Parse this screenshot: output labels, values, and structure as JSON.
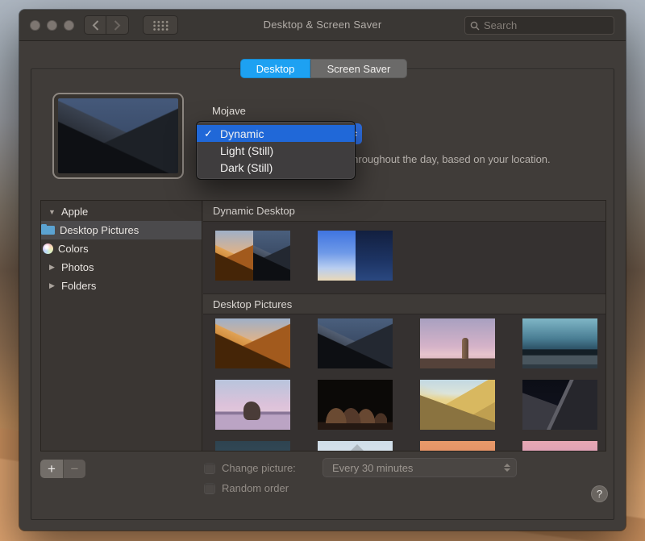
{
  "titlebar": {
    "title": "Desktop & Screen Saver",
    "search_placeholder": "Search"
  },
  "tabs": {
    "desktop": "Desktop",
    "screen_saver": "Screen Saver"
  },
  "preview": {
    "name": "Mojave",
    "caption": "The desktop picture changes throughout the day, based on your location."
  },
  "dropdown": {
    "checkmark": "✓",
    "selected": "Dynamic",
    "options": [
      "Dynamic",
      "Light (Still)",
      "Dark (Still)"
    ]
  },
  "sidebar": {
    "items": [
      {
        "label": "Apple",
        "state": "expanded"
      },
      {
        "label": "Desktop Pictures",
        "selected": true,
        "icon": "folder-icon"
      },
      {
        "label": "Colors",
        "icon": "color-sphere-icon"
      },
      {
        "label": "Photos",
        "state": "collapsed"
      },
      {
        "label": "Folders",
        "state": "collapsed"
      }
    ]
  },
  "sections": [
    {
      "title": "Dynamic Desktop",
      "thumbnails": [
        "mojave-dynamic-thumbnail",
        "solar-gradients-thumbnail"
      ]
    },
    {
      "title": "Desktop Pictures",
      "thumbnails": [
        "mojave-day-thumbnail",
        "mojave-night-thumbnail",
        "desert-monument-thumbnail",
        "playa-dusk-thumbnail",
        "pink-salt-lake-thumbnail",
        "tufa-night-thumbnail",
        "yellow-dunes-thumbnail",
        "dark-dune-thumbnail",
        "teal-dusk-thumbnail",
        "mountain-peak-thumbnail",
        "orange-clouds-thumbnail",
        "pink-clouds-thumbnail"
      ]
    }
  ],
  "footer": {
    "add": "+",
    "remove": "−",
    "change_picture": "Change picture:",
    "interval": "Every 30 minutes",
    "random_order": "Random order",
    "help": "?"
  },
  "colors": {
    "menu_selection_blue": "#2068d8",
    "tab_selected_blue": "#1da1f2",
    "popup_button_blue": "#2e6ee0",
    "folder_icon_blue": "#5ba3d2"
  }
}
